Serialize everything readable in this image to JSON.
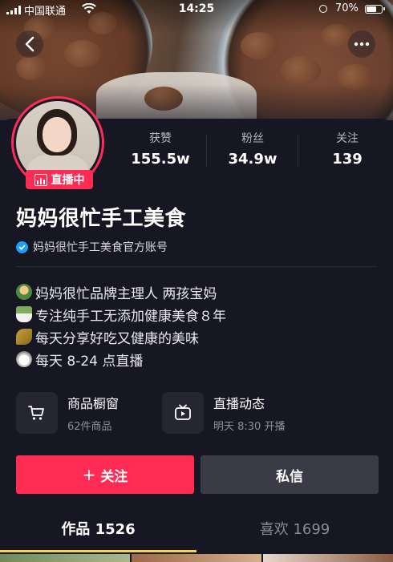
{
  "status_bar": {
    "carrier": "中国联通",
    "time": "14:25",
    "battery_percent": "70%",
    "battery_level": 0.7
  },
  "nav": {
    "back_icon": "chevron-left-icon",
    "more_icon": "more-dots-icon"
  },
  "profile": {
    "live_badge": "直播中",
    "nickname": "妈妈很忙手工美食",
    "verification": "妈妈很忙手工美食官方账号",
    "stats": [
      {
        "label": "获赞",
        "value": "155.5w"
      },
      {
        "label": "粉丝",
        "value": "34.9w"
      },
      {
        "label": "关注",
        "value": "139"
      }
    ],
    "bio": [
      {
        "icon": "avatar-emoji-icon",
        "text": "妈妈很忙品牌主理人 两孩宝妈"
      },
      {
        "icon": "tea-cup-emoji-icon",
        "text": "专注纯手工无添加健康美食８年"
      },
      {
        "icon": "food-plate-emoji-icon",
        "text": "每天分享好吃又健康的美味"
      },
      {
        "icon": "stopwatch-emoji-icon",
        "text": "每天 8-24 点直播"
      }
    ]
  },
  "entries": {
    "shop": {
      "title": "商品橱窗",
      "subtitle": "62件商品",
      "icon": "shopping-cart-icon"
    },
    "live": {
      "title": "直播动态",
      "subtitle": "明天 8:30 开播",
      "icon": "tv-play-icon"
    }
  },
  "actions": {
    "follow_label": "关注",
    "message_label": "私信"
  },
  "tabs": [
    {
      "label": "作品 1526",
      "active": true
    },
    {
      "label": "喜欢 1699",
      "active": false
    }
  ],
  "colors": {
    "accent": "#fe2c55",
    "background": "#161722",
    "secondary_button": "#3a3b46",
    "tab_indicator": "#f8d548",
    "verified": "#20a0f5"
  }
}
